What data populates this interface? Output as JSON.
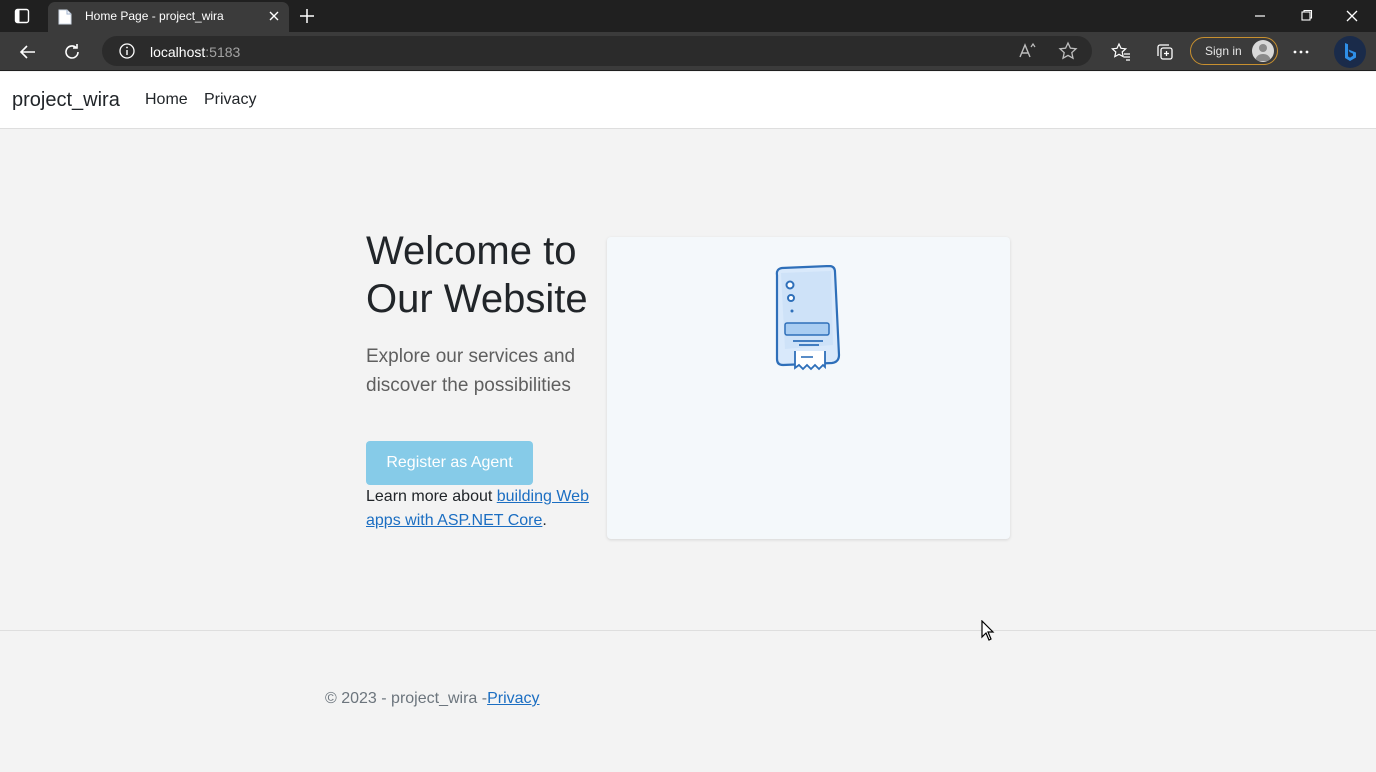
{
  "browser": {
    "tab_title": "Home Page - project_wira",
    "address_host": "localhost",
    "address_port": ":5183",
    "signin_label": "Sign in",
    "icons": [
      "tab-actions-icon",
      "page-favicon-icon",
      "close-icon",
      "plus-icon",
      "minimize-icon",
      "restore-icon",
      "close-window-icon",
      "back-arrow-icon",
      "refresh-icon",
      "info-icon",
      "read-aloud-icon",
      "star-icon",
      "favorites-icon",
      "collections-icon",
      "more-icon",
      "bing-copilot-icon"
    ]
  },
  "nav": {
    "brand": "project_wira",
    "links": [
      {
        "label": "Home"
      },
      {
        "label": "Privacy"
      }
    ]
  },
  "hero": {
    "title": "Welcome to Our Website",
    "subtitle": "Explore our services and discover the possibilities",
    "register_label": "Register as Agent",
    "learn_prefix": "Learn more about ",
    "learn_link": "building Web apps with ASP.NET Core",
    "learn_suffix": "."
  },
  "footer": {
    "text": "© 2023 - project_wira -",
    "privacy_link": "Privacy"
  },
  "colors": {
    "accent_link": "#1b6ec2",
    "register_button": "#86cbe8",
    "card_background": "#f4f8fb",
    "illustration_stroke": "#2e6fb9"
  }
}
